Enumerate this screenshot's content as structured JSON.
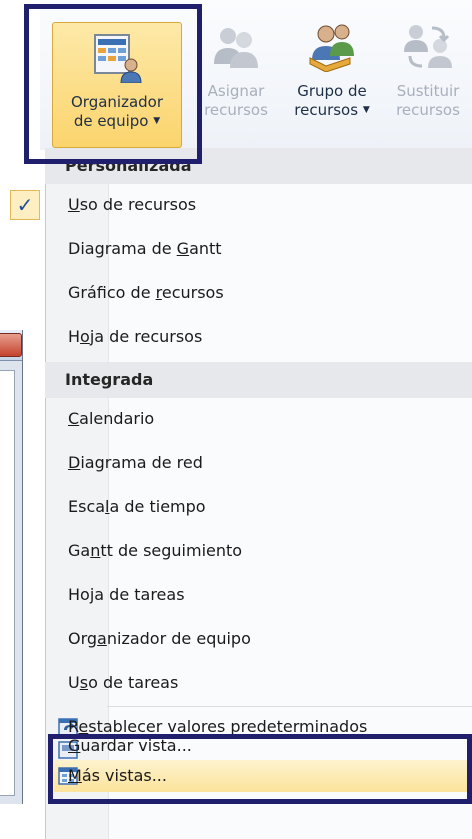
{
  "ribbon": {
    "buttons": [
      {
        "line1": "Organizador",
        "line2": "de equipo",
        "has_arrow": true,
        "icon": "team-planner-icon",
        "state": "active"
      },
      {
        "line1": "Asignar",
        "line2": "recursos",
        "has_arrow": false,
        "icon": "assign-resources-icon",
        "state": "disabled"
      },
      {
        "line1": "Grupo de",
        "line2": "recursos",
        "has_arrow": true,
        "icon": "resource-pool-icon",
        "state": "enabled"
      },
      {
        "line1": "Sustituir",
        "line2": "recursos",
        "has_arrow": false,
        "icon": "substitute-resources-icon",
        "state": "disabled"
      }
    ]
  },
  "menu": {
    "section_custom": "Personalizada",
    "custom_items": [
      {
        "pre": "",
        "u": "U",
        "post": "so de recursos",
        "checked": true
      },
      {
        "pre": "Diagrama de ",
        "u": "G",
        "post": "antt",
        "checked": false
      },
      {
        "pre": "Gráfico de ",
        "u": "r",
        "post": "ecursos",
        "checked": false
      },
      {
        "pre": "H",
        "u": "o",
        "post": "ja de recursos",
        "checked": false
      }
    ],
    "section_builtin": "Integrada",
    "builtin_items": [
      {
        "pre": "",
        "u": "C",
        "post": "alendario"
      },
      {
        "pre": "",
        "u": "D",
        "post": "iagrama de red"
      },
      {
        "pre": "Esca",
        "u": "l",
        "post": "a de tiempo"
      },
      {
        "pre": "Ga",
        "u": "n",
        "post": "tt de seguimiento"
      },
      {
        "pre": "Hoja de tareas",
        "u": "",
        "post": ""
      },
      {
        "pre": "Org",
        "u": "a",
        "post": "nizador de equipo"
      },
      {
        "pre": "U",
        "u": "s",
        "post": "o de tareas"
      }
    ],
    "actions": [
      {
        "pre": "R",
        "u": "e",
        "post": "stablecer valores predeterminados",
        "icon": "reset-icon"
      },
      {
        "pre": "",
        "u": "G",
        "post": "uardar vista...",
        "icon": "save-view-icon"
      },
      {
        "pre": "",
        "u": "M",
        "post": "ás vistas...",
        "icon": "more-views-icon",
        "highlighted": true
      }
    ]
  },
  "colors": {
    "highlight_border": "#1f1f6e",
    "hover_fill": "#fce39a",
    "section_bg": "#e6e8ec"
  }
}
